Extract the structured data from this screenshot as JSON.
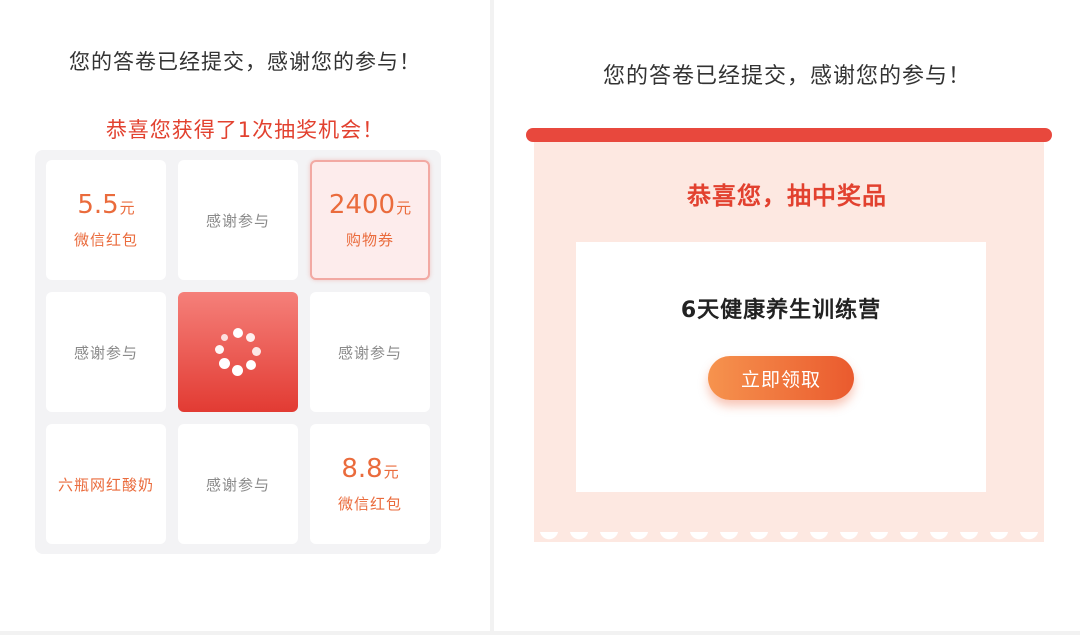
{
  "left": {
    "submit_message": "您的答卷已经提交，感谢您的参与！",
    "congrats_message": "恭喜您获得了1次抽奖机会！",
    "cells": {
      "r0c0": {
        "amount": "5.5",
        "unit": "元",
        "desc": "微信红包"
      },
      "r0c1": {
        "text": "感谢参与"
      },
      "r0c2": {
        "amount": "2400",
        "unit": "元",
        "desc": "购物券"
      },
      "r1c0": {
        "text": "感谢参与"
      },
      "r1c2": {
        "text": "感谢参与"
      },
      "r2c0": {
        "text": "六瓶网红酸奶"
      },
      "r2c1": {
        "text": "感谢参与"
      },
      "r2c2": {
        "amount": "8.8",
        "unit": "元",
        "desc": "微信红包"
      }
    },
    "center_icon": "loading-spinner-icon"
  },
  "right": {
    "submit_message": "您的答卷已经提交，感谢您的参与！",
    "prize_title": "恭喜您，抽中奖品",
    "prize_name": "6天健康养生训练营",
    "claim_button": "立即领取"
  },
  "colors": {
    "accent_red": "#e2412f",
    "prize_orange": "#ea6b3c",
    "ticket_bg": "#fde8e1",
    "button_gradient_start": "#f6934e",
    "button_gradient_end": "#ea5a2e"
  }
}
